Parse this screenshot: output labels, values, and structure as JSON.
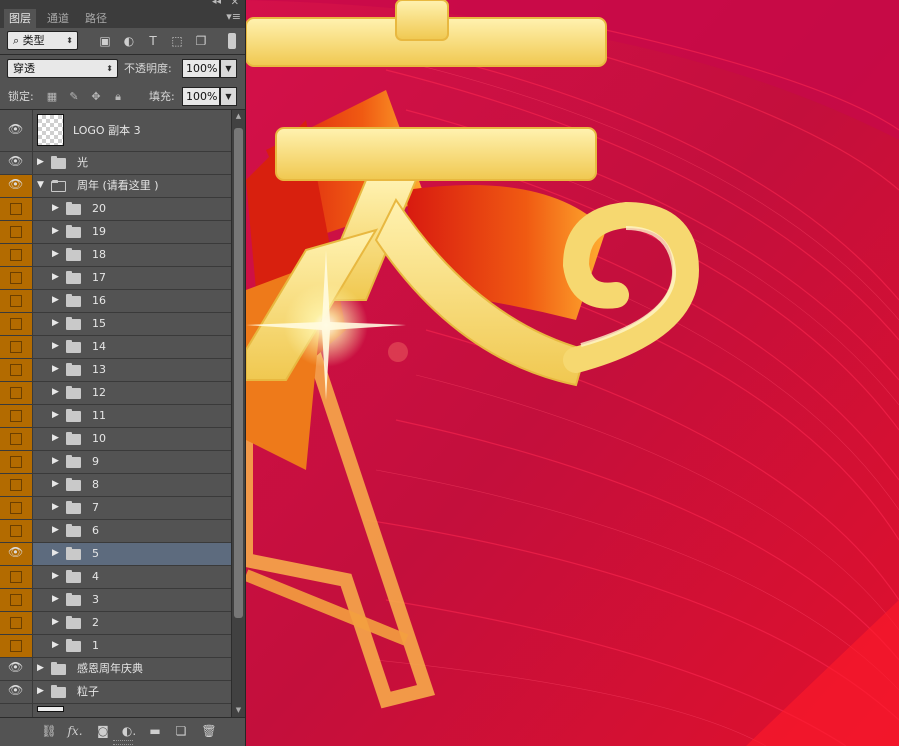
{
  "panel": {
    "tabs": [
      "图层",
      "通道",
      "路径"
    ],
    "filter": {
      "label": "类型"
    },
    "blend_mode": "穿透",
    "opacity": {
      "label": "不透明度:",
      "value": "100%"
    },
    "lock_label": "锁定:",
    "fill": {
      "label": "填充:",
      "value": "100%"
    }
  },
  "layers": [
    {
      "name": "LOGO 副本 3",
      "kind": "layer",
      "visible": true,
      "indent": 0
    },
    {
      "name": "光",
      "kind": "group",
      "visible": true,
      "indent": 0
    },
    {
      "name": "周年 (请看这里 )",
      "kind": "group-open",
      "visible": true,
      "indent": 0,
      "vis_color": "orange"
    },
    {
      "name": "20",
      "kind": "group",
      "visible": false,
      "indent": 1
    },
    {
      "name": "19",
      "kind": "group",
      "visible": false,
      "indent": 1
    },
    {
      "name": "18",
      "kind": "group",
      "visible": false,
      "indent": 1
    },
    {
      "name": "17",
      "kind": "group",
      "visible": false,
      "indent": 1
    },
    {
      "name": "16",
      "kind": "group",
      "visible": false,
      "indent": 1
    },
    {
      "name": "15",
      "kind": "group",
      "visible": false,
      "indent": 1
    },
    {
      "name": "14",
      "kind": "group",
      "visible": false,
      "indent": 1
    },
    {
      "name": "13",
      "kind": "group",
      "visible": false,
      "indent": 1
    },
    {
      "name": "12",
      "kind": "group",
      "visible": false,
      "indent": 1
    },
    {
      "name": "11",
      "kind": "group",
      "visible": false,
      "indent": 1
    },
    {
      "name": "10",
      "kind": "group",
      "visible": false,
      "indent": 1
    },
    {
      "name": "9",
      "kind": "group",
      "visible": false,
      "indent": 1
    },
    {
      "name": "8",
      "kind": "group",
      "visible": false,
      "indent": 1
    },
    {
      "name": "7",
      "kind": "group",
      "visible": false,
      "indent": 1
    },
    {
      "name": "6",
      "kind": "group",
      "visible": false,
      "indent": 1
    },
    {
      "name": "5",
      "kind": "group",
      "visible": true,
      "indent": 1,
      "selected": true
    },
    {
      "name": "4",
      "kind": "group",
      "visible": false,
      "indent": 1
    },
    {
      "name": "3",
      "kind": "group",
      "visible": false,
      "indent": 1
    },
    {
      "name": "2",
      "kind": "group",
      "visible": false,
      "indent": 1
    },
    {
      "name": "1",
      "kind": "group",
      "visible": false,
      "indent": 1
    },
    {
      "name": "感恩周年庆典",
      "kind": "group",
      "visible": true,
      "indent": 0
    },
    {
      "name": "粒子",
      "kind": "group",
      "visible": true,
      "indent": 0
    }
  ],
  "colors": {
    "panel_bg": "#535353",
    "orange_visibility": "#b36b00",
    "selected_row": "#5d6b7e",
    "canvas_red": "#c4103c",
    "gold": "#f6dc7a"
  }
}
